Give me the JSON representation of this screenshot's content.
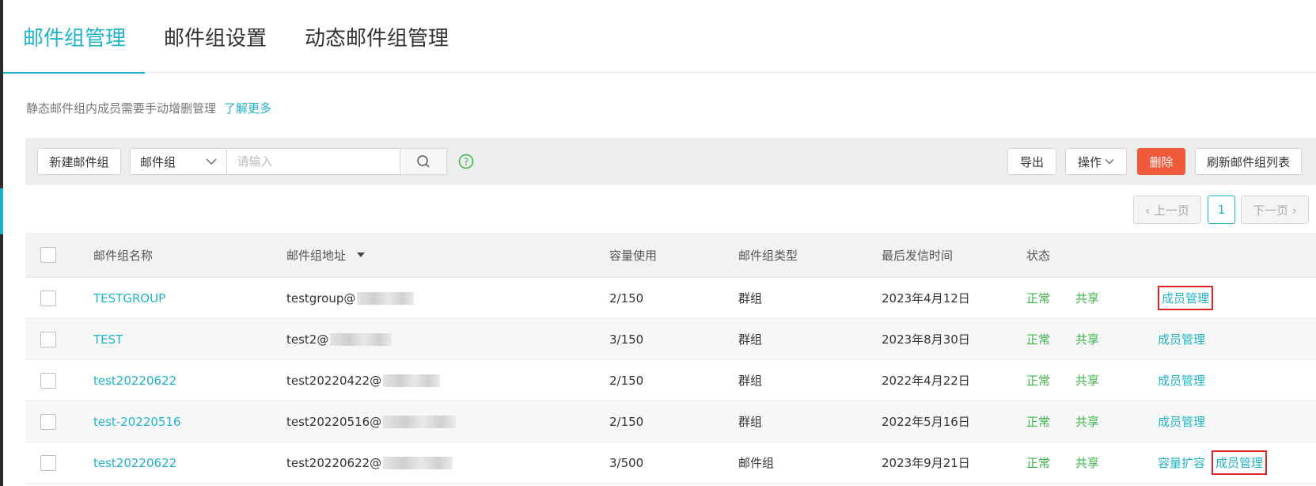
{
  "tabs": [
    {
      "label": "邮件组管理"
    },
    {
      "label": "邮件组设置"
    },
    {
      "label": "动态邮件组管理"
    }
  ],
  "notice": {
    "text": "静态邮件组内成员需要手动增删管理",
    "link": "了解更多"
  },
  "toolbar": {
    "new_group": "新建邮件组",
    "search_type": "邮件组",
    "search_placeholder": "请输入",
    "export": "导出",
    "operations": "操作",
    "delete": "删除",
    "refresh": "刷新邮件组列表"
  },
  "pager": {
    "prev": "‹ 上一页",
    "page": "1",
    "next": "下一页 ›"
  },
  "table": {
    "headers": {
      "name": "邮件组名称",
      "address": "邮件组地址",
      "capacity": "容量使用",
      "type": "邮件组类型",
      "last_sent": "最后发信时间",
      "status": "状态"
    },
    "rows": [
      {
        "name": "TESTGROUP",
        "address": "testgroup@",
        "capacity": "2/150",
        "type": "群组",
        "last_sent": "2023年4月12日",
        "status": "正常",
        "share": "共享",
        "op_manage": "成员管理"
      },
      {
        "name": "TEST",
        "address": "test2@",
        "capacity": "3/150",
        "type": "群组",
        "last_sent": "2023年8月30日",
        "status": "正常",
        "share": "共享",
        "op_manage": "成员管理"
      },
      {
        "name": "test20220622",
        "address": "test20220422@",
        "capacity": "2/150",
        "type": "群组",
        "last_sent": "2022年4月22日",
        "status": "正常",
        "share": "共享",
        "op_manage": "成员管理"
      },
      {
        "name": "test-20220516",
        "address": "test20220516@",
        "capacity": "2/150",
        "type": "群组",
        "last_sent": "2022年5月16日",
        "status": "正常",
        "share": "共享",
        "op_manage": "成员管理"
      },
      {
        "name": "test20220622",
        "address": "test20220622@",
        "capacity": "3/500",
        "type": "邮件组",
        "last_sent": "2023年9月21日",
        "status": "正常",
        "share": "共享",
        "op_expand": "容量扩容",
        "op_manage": "成员管理"
      }
    ]
  },
  "colors": {
    "accent": "#1fb3c9",
    "danger": "#f05a3a",
    "status_green": "#3bb54a",
    "highlight_box": "#e02424"
  }
}
